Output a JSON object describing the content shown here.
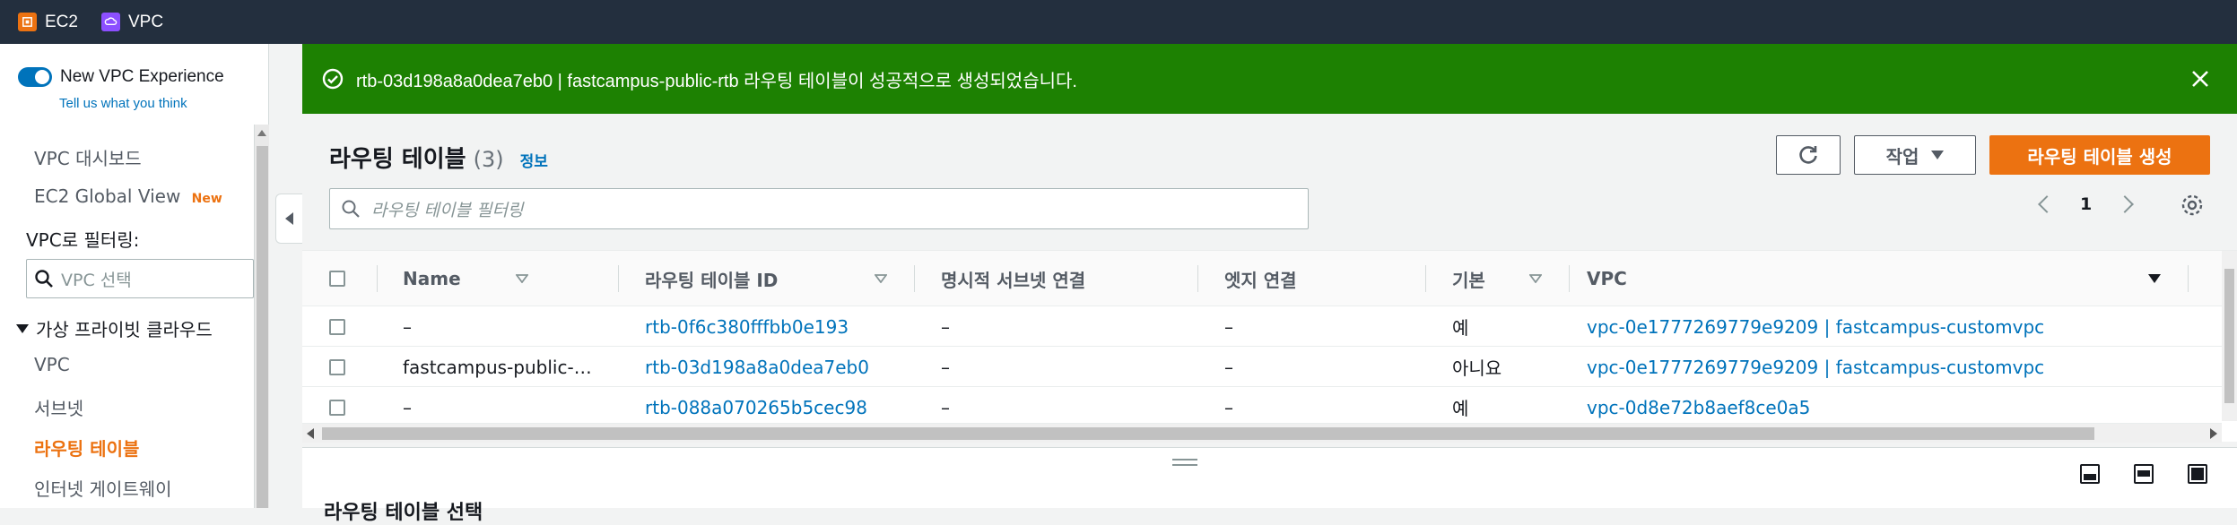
{
  "topbar": {
    "services": [
      {
        "label": "EC2",
        "color": "#ec7211",
        "icon": "ec2-icon"
      },
      {
        "label": "VPC",
        "color": "#8c4fff",
        "icon": "vpc-icon"
      }
    ]
  },
  "sidebar": {
    "toggle_label": "New VPC Experience",
    "tell_link": "Tell us what you think",
    "nav_top": [
      "VPC 대시보드",
      "EC2 Global View"
    ],
    "new_badge": "New",
    "filter_label": "VPC로 필터링:",
    "vpc_select_placeholder": "VPC 선택",
    "section": "가상 프라이빗 클라우드",
    "items": [
      "VPC",
      "서브넷",
      "라우팅 테이블",
      "인터넷 게이트웨이"
    ],
    "active_item": "라우팅 테이블"
  },
  "flash": {
    "message": "rtb-03d198a8a0dea7eb0 | fastcampus-public-rtb 라우팅 테이블이 성공적으로 생성되었습니다.",
    "color": "#1d8102"
  },
  "panel": {
    "title": "라우팅 테이블",
    "count": "(3)",
    "info": "정보",
    "actions_label": "작업",
    "create_label": "라우팅 테이블 생성",
    "search_placeholder": "라우팅 테이블 필터링",
    "page": "1"
  },
  "table": {
    "columns": [
      "Name",
      "라우팅 테이블 ID",
      "명시적 서브넷 연결",
      "엣지 연결",
      "기본",
      "VPC"
    ],
    "rows": [
      {
        "name": "–",
        "id": "rtb-0f6c380fffbb0e193",
        "subnet": "–",
        "edge": "–",
        "main": "예",
        "vpc": "vpc-0e1777269779e9209 | fastcampus-customvpc"
      },
      {
        "name": "fastcampus-public-…",
        "id": "rtb-03d198a8a0dea7eb0",
        "subnet": "–",
        "edge": "–",
        "main": "아니요",
        "vpc": "vpc-0e1777269779e9209 | fastcampus-customvpc"
      },
      {
        "name": "–",
        "id": "rtb-088a070265b5cec98",
        "subnet": "–",
        "edge": "–",
        "main": "예",
        "vpc": "vpc-0d8e72b8aef8ce0a5"
      }
    ]
  },
  "detail": {
    "title": "라우팅 테이블 선택"
  },
  "colors": {
    "topbar": "#232f3e",
    "accent_orange": "#ec7211",
    "link_blue": "#0073bb",
    "success_green": "#1d8102"
  }
}
